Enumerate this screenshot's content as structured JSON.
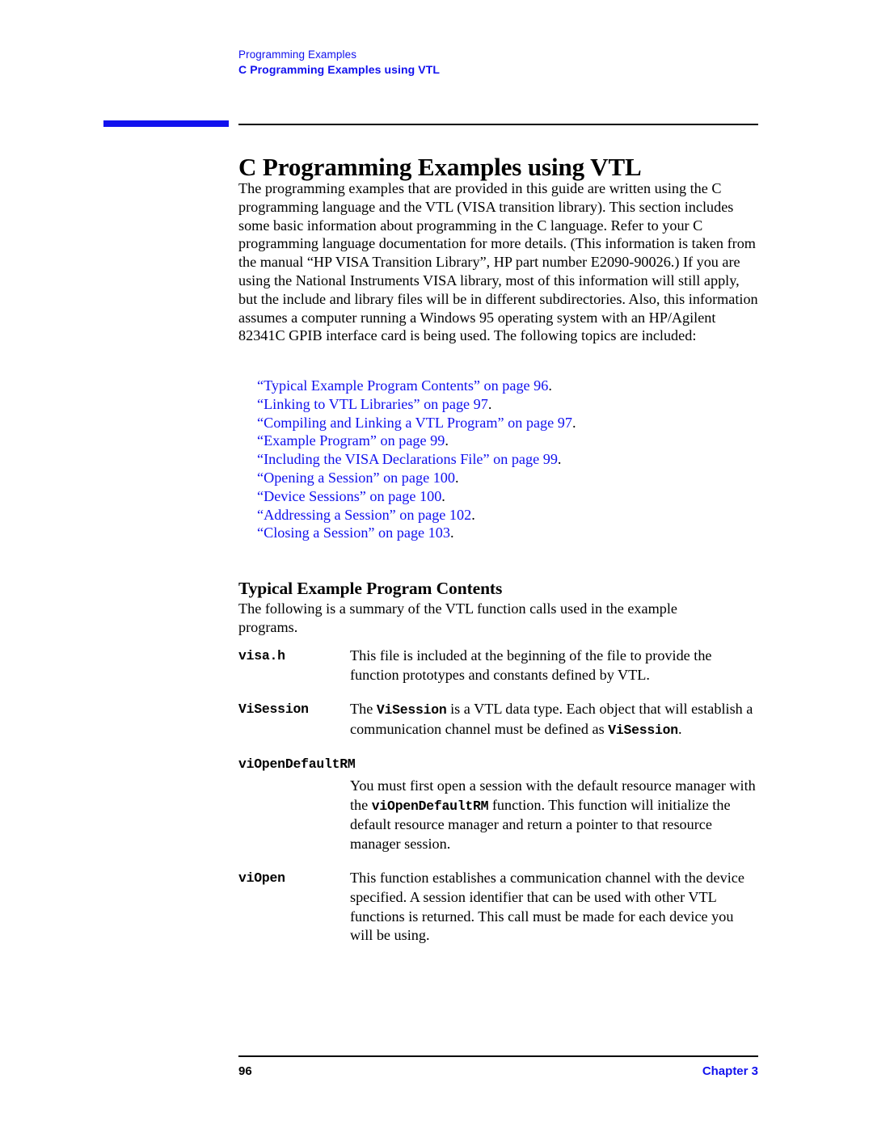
{
  "header": {
    "line1": "Programming Examples",
    "line2": "C Programming Examples using VTL"
  },
  "title": "C Programming Examples using VTL",
  "intro_paragraph": "The programming examples that are provided in this guide are written using the C programming language and the VTL (VISA transition library). This section includes some basic information about programming in the C language. Refer to your C programming language documentation for more details. (This information is taken from the manual “HP VISA Transition Library”, HP part number E2090-90026.) If you are using the National Instruments VISA library, most of this information will still apply, but the include and library files will be in different subdirectories. Also, this information assumes a computer running a Windows 95 operating system with an HP/Agilent 82341C GPIB interface card is being used. The following topics are included:",
  "xref_links": [
    {
      "text": "“Typical Example Program Contents” on page 96",
      "period": "."
    },
    {
      "text": "“Linking to VTL Libraries” on page 97",
      "period": "."
    },
    {
      "text": "“Compiling and Linking a VTL Program” on page 97",
      "period": "."
    },
    {
      "text": "“Example Program” on page 99",
      "period": "."
    },
    {
      "text": "“Including the VISA Declarations File” on page 99",
      "period": "."
    },
    {
      "text": "“Opening a Session” on page 100",
      "period": "."
    },
    {
      "text": "“Device Sessions” on page 100",
      "period": "."
    },
    {
      "text": "“Addressing a Session” on page 102",
      "period": "."
    },
    {
      "text": "“Closing a Session” on page 103",
      "period": "."
    }
  ],
  "section_heading": "Typical Example Program Contents",
  "summary_paragraph": "The following is a summary of the VTL function calls used in the example programs.",
  "definitions": [
    {
      "term": "visa.h",
      "desc_part1": "This file is included at the beginning of the file to provide the function prototypes and constants defined by VTL.",
      "code1": "",
      "desc_part2": "",
      "code2": "",
      "desc_part3": ""
    },
    {
      "term": "ViSession",
      "desc_part1": "The ",
      "code1": "ViSession",
      "desc_part2": " is a VTL data type. Each object that will establish a communication channel must be defined as ",
      "code2": "ViSession",
      "desc_part3": "."
    },
    {
      "term": "viOpenDefaultRM",
      "desc_part1": "You must first open a session with the default resource manager with the ",
      "code1": "viOpenDefaultRM",
      "desc_part2": " function. This function will initialize the default resource manager and return a pointer to that resource manager session.",
      "code2": "",
      "desc_part3": ""
    },
    {
      "term": "viOpen",
      "desc_part1": "This function establishes a communication channel with the device specified. A session identifier that can be used with other VTL functions is returned. This call must be made for each device you will be using.",
      "code1": "",
      "desc_part2": "",
      "code2": "",
      "desc_part3": ""
    }
  ],
  "footer": {
    "page_number": "96",
    "chapter": "Chapter 3"
  },
  "colors": {
    "link_blue": "#1111ee",
    "text_black": "#000000",
    "page_background": "#ffffff"
  }
}
